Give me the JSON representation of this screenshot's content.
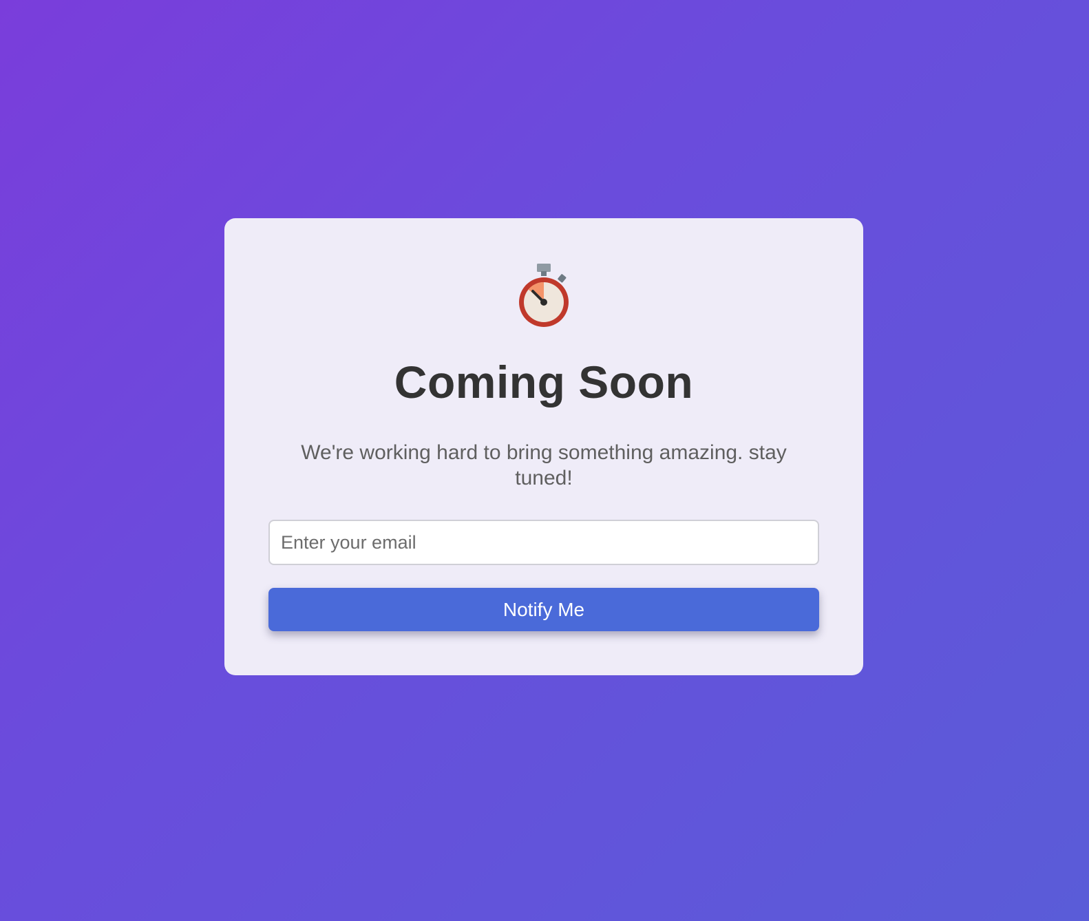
{
  "hero": {
    "icon": "stopwatch-icon",
    "title": "Coming Soon",
    "subtitle": "We're working hard to bring something amazing. stay tuned!"
  },
  "signup": {
    "email_placeholder": "Enter your email",
    "email_value": "",
    "button_label": "Notify Me"
  },
  "colors": {
    "background_start": "#7a3ddb",
    "background_end": "#5a5cd8",
    "card": "#efecf8",
    "button": "#4a6ad9",
    "title": "#333333",
    "subtitle": "#5f5f5f"
  }
}
